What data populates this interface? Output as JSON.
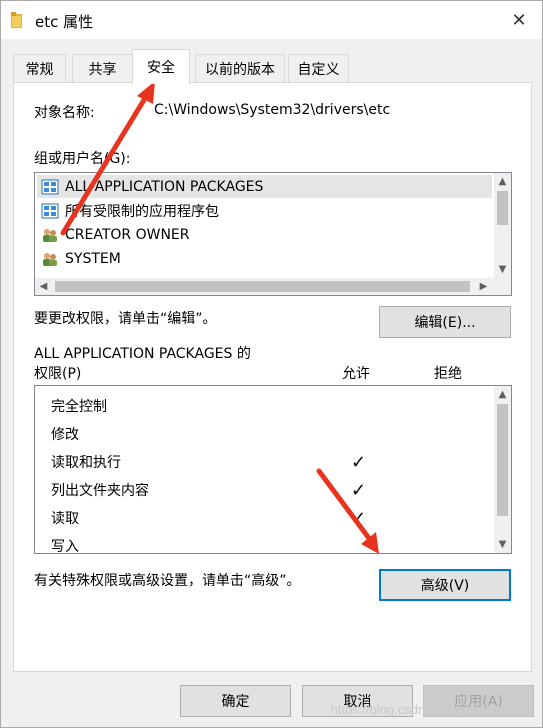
{
  "window": {
    "title": "etc 属性",
    "close_symbol": "✕"
  },
  "tabs": [
    {
      "label": "常规"
    },
    {
      "label": "共享"
    },
    {
      "label": "安全",
      "active": true
    },
    {
      "label": "以前的版本"
    },
    {
      "label": "自定义"
    }
  ],
  "security": {
    "object_name_label": "对象名称:",
    "object_name_value": "C:\\Windows\\System32\\drivers\\etc",
    "groups_label": "组或用户名(G):",
    "groups": [
      {
        "name": "ALL APPLICATION PACKAGES",
        "icon": "package-group-icon",
        "selected": true
      },
      {
        "name": "所有受限制的应用程序包",
        "icon": "package-group-icon"
      },
      {
        "name": "CREATOR OWNER",
        "icon": "users-icon"
      },
      {
        "name": "SYSTEM",
        "icon": "users-icon"
      }
    ],
    "edit_hint": "要更改权限，请单击“编辑”。",
    "edit_button": "编辑(E)...",
    "permissions_for": "ALL APPLICATION PACKAGES 的",
    "permissions_label": "权限(P)",
    "allow_header": "允许",
    "deny_header": "拒绝",
    "permissions": [
      {
        "name": "完全控制",
        "allow": false,
        "deny": false
      },
      {
        "name": "修改",
        "allow": false,
        "deny": false
      },
      {
        "name": "读取和执行",
        "allow": true,
        "deny": false
      },
      {
        "name": "列出文件夹内容",
        "allow": true,
        "deny": false
      },
      {
        "name": "读取",
        "allow": true,
        "deny": false
      },
      {
        "name": "写入",
        "allow": false,
        "deny": false
      }
    ],
    "check_symbol": "✓",
    "advanced_hint": "有关特殊权限或高级设置，请单击“高级”。",
    "advanced_button": "高级(V)"
  },
  "footer": {
    "ok": "确定",
    "cancel": "取消",
    "apply": "应用(A)"
  },
  "watermark": "https://blog.csdn.net/qq_46046959",
  "colors": {
    "selection": "#e5e5e5",
    "accent": "#0078d7",
    "annotation_arrow": "#e8331f"
  }
}
